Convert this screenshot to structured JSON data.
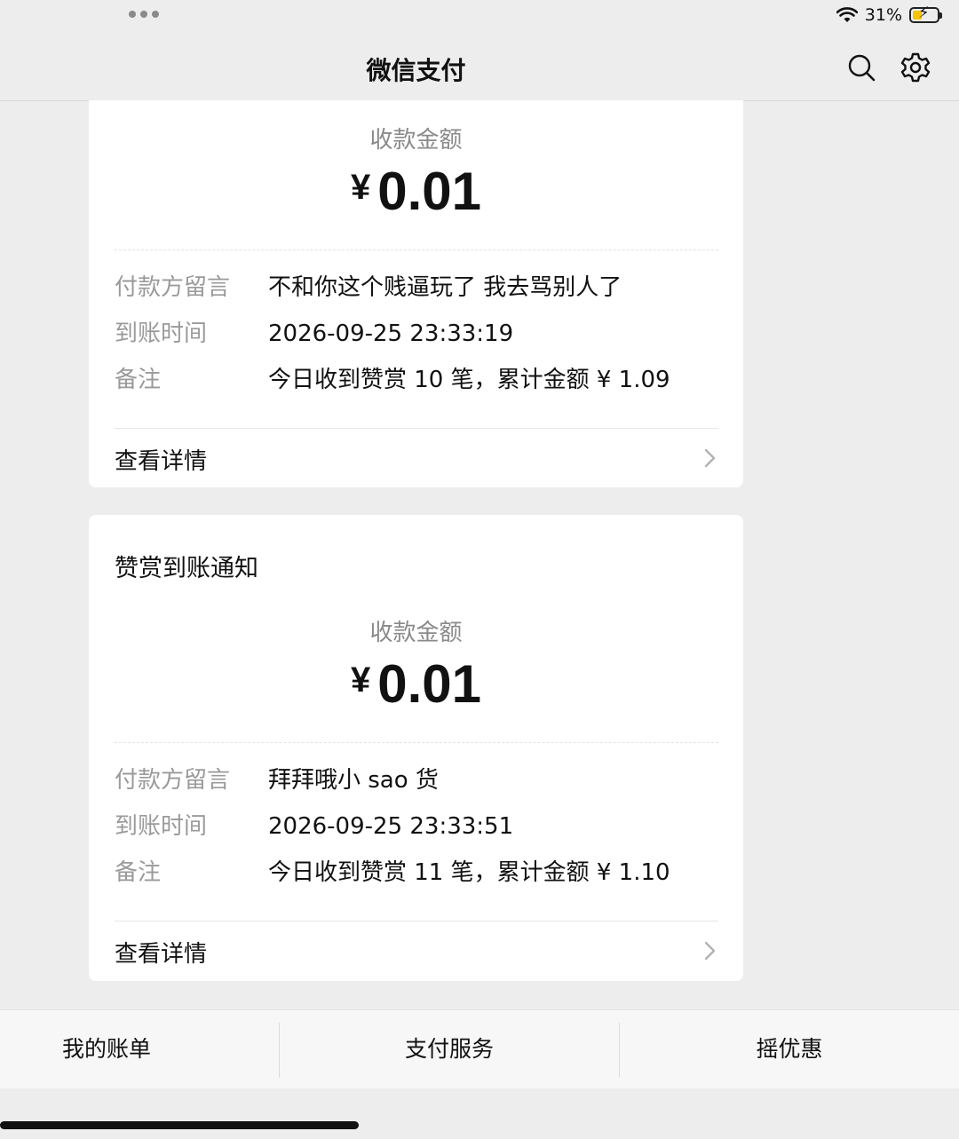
{
  "status": {
    "battery_text": "31%"
  },
  "header": {
    "title": "微信支付"
  },
  "card1": {
    "amount_label": "收款金额",
    "currency": "¥",
    "amount": "0.01",
    "rows": [
      {
        "label": "付款方留言",
        "value": "不和你这个贱逼玩了 我去骂别人了"
      },
      {
        "label": "到账时间",
        "value": "2026-09-25 23:33:19"
      },
      {
        "label": "备注",
        "value": "今日收到赞赏 10 笔，累计金额 ¥ 1.09"
      }
    ],
    "detail_label": "查看详情"
  },
  "card2": {
    "title": "赞赏到账通知",
    "amount_label": "收款金额",
    "currency": "¥",
    "amount": "0.01",
    "rows": [
      {
        "label": "付款方留言",
        "value": "拜拜哦小 sao 货"
      },
      {
        "label": "到账时间",
        "value": "2026-09-25 23:33:51"
      },
      {
        "label": "备注",
        "value": "今日收到赞赏 11 笔，累计金额 ¥ 1.10"
      }
    ],
    "detail_label": "查看详情"
  },
  "tabs": [
    {
      "label": "我的账单"
    },
    {
      "label": "支付服务"
    },
    {
      "label": "摇优惠"
    }
  ],
  "colors": {
    "background": "#ededed",
    "card": "#ffffff",
    "muted_text": "#9a9a9a",
    "battery_fill": "#f5c400"
  },
  "icons": [
    "more-dots-icon",
    "wifi-icon",
    "battery-charging-icon",
    "search-icon",
    "settings-gear-icon",
    "chevron-right-icon"
  ]
}
